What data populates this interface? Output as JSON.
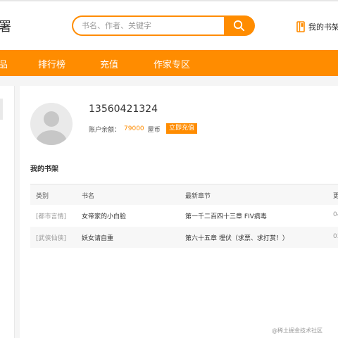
{
  "header": {
    "logo_fragment": "署",
    "search": {
      "placeholder": "书名、作者、关键字",
      "value": ""
    },
    "shelf_link": "我的书架"
  },
  "nav": {
    "items": [
      "品",
      "排行榜",
      "充值",
      "作家专区"
    ]
  },
  "user": {
    "phone": "13560421324",
    "balance_label": "账户余额：",
    "balance_amount": "79000",
    "balance_unit": "屋币",
    "recharge_label": "立即充值"
  },
  "bookshelf": {
    "title": "我的书架",
    "columns": [
      "类别",
      "书名",
      "最新章节",
      "更"
    ],
    "rows": [
      {
        "category": "[都市言情]",
        "book": "女帝家的小白脸",
        "chapter": "第一千二百四十三章 FIV病毒",
        "updated": "04"
      },
      {
        "category": "[武侠仙侠]",
        "book": "妖女请自重",
        "chapter": "第六十五章 埋伏（求票、求打赏！）",
        "updated": "03"
      }
    ]
  },
  "watermark": "@稀土掘金技术社区",
  "colors": {
    "accent": "#ff8c00"
  }
}
